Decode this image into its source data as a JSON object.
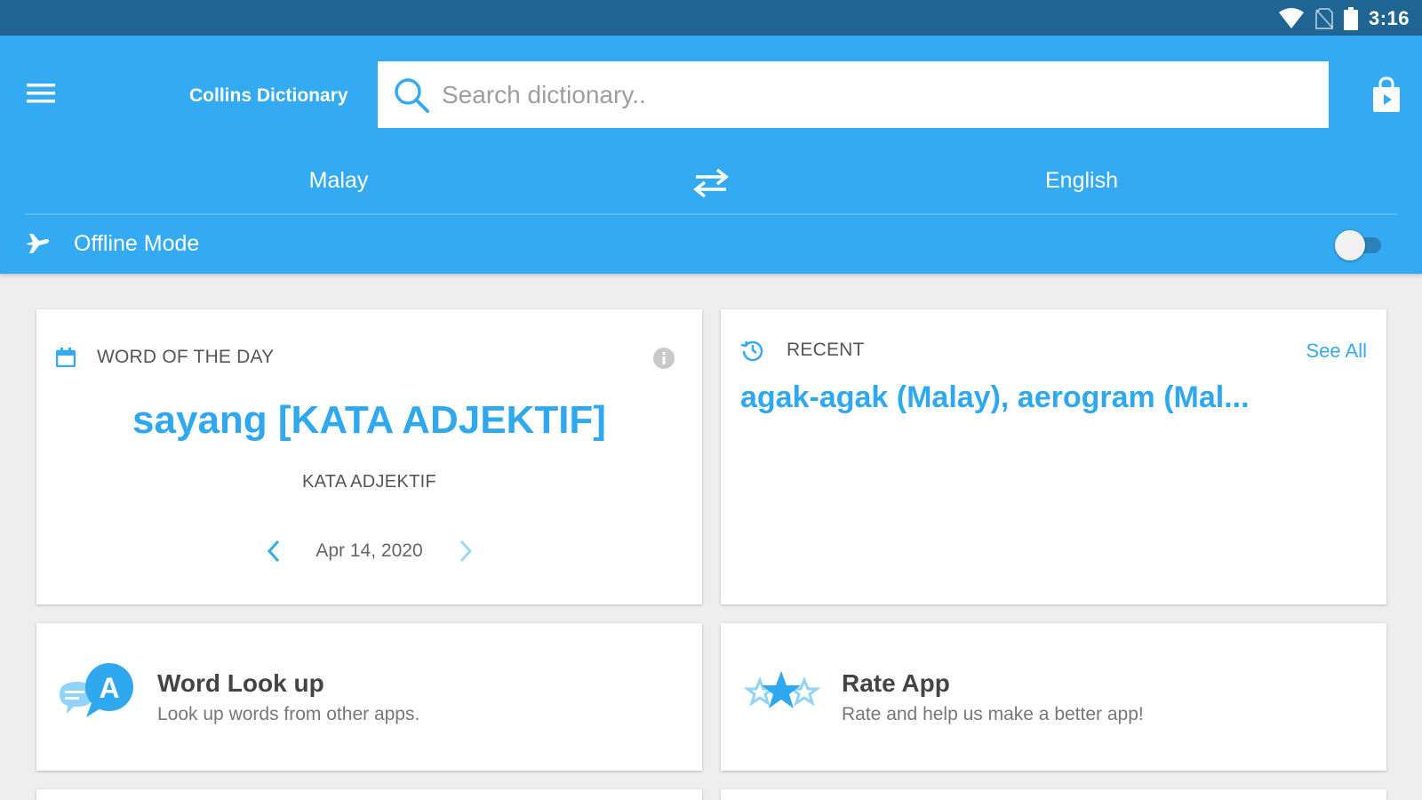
{
  "status_bar": {
    "time": "3:16",
    "icons": [
      "wifi-icon",
      "no-sim-icon",
      "battery-icon"
    ]
  },
  "app_bar": {
    "title": "Collins Dictionary",
    "search": {
      "placeholder": "Search dictionary..",
      "value": ""
    },
    "menu_icon": "hamburger-menu-icon",
    "store_icon": "shopping-bag-icon"
  },
  "languages": {
    "source": "Malay",
    "target": "English",
    "swap_icon": "swap-arrows-icon"
  },
  "offline_mode": {
    "label": "Offline Mode",
    "enabled": false
  },
  "word_of_the_day": {
    "header": "WORD OF THE DAY",
    "word": "sayang [KATA ADJEKTIF]",
    "part_of_speech": "KATA ADJEKTIF",
    "date": "Apr 14, 2020"
  },
  "recent": {
    "header": "RECENT",
    "see_all": "See All",
    "items": "agak-agak (Malay), aerogram (Mal..."
  },
  "features": [
    {
      "title": "Word Look up",
      "subtitle": "Look up words from other apps.",
      "icon": "chat-bubbles-a-icon"
    },
    {
      "title": "Rate App",
      "subtitle": "Rate and help us make a better app!",
      "icon": "stars-icon"
    }
  ],
  "colors": {
    "primary": "#33aaf2",
    "status_bar": "#1e6593",
    "accent_text": "#2fa8ef",
    "background": "#eeeeee"
  }
}
